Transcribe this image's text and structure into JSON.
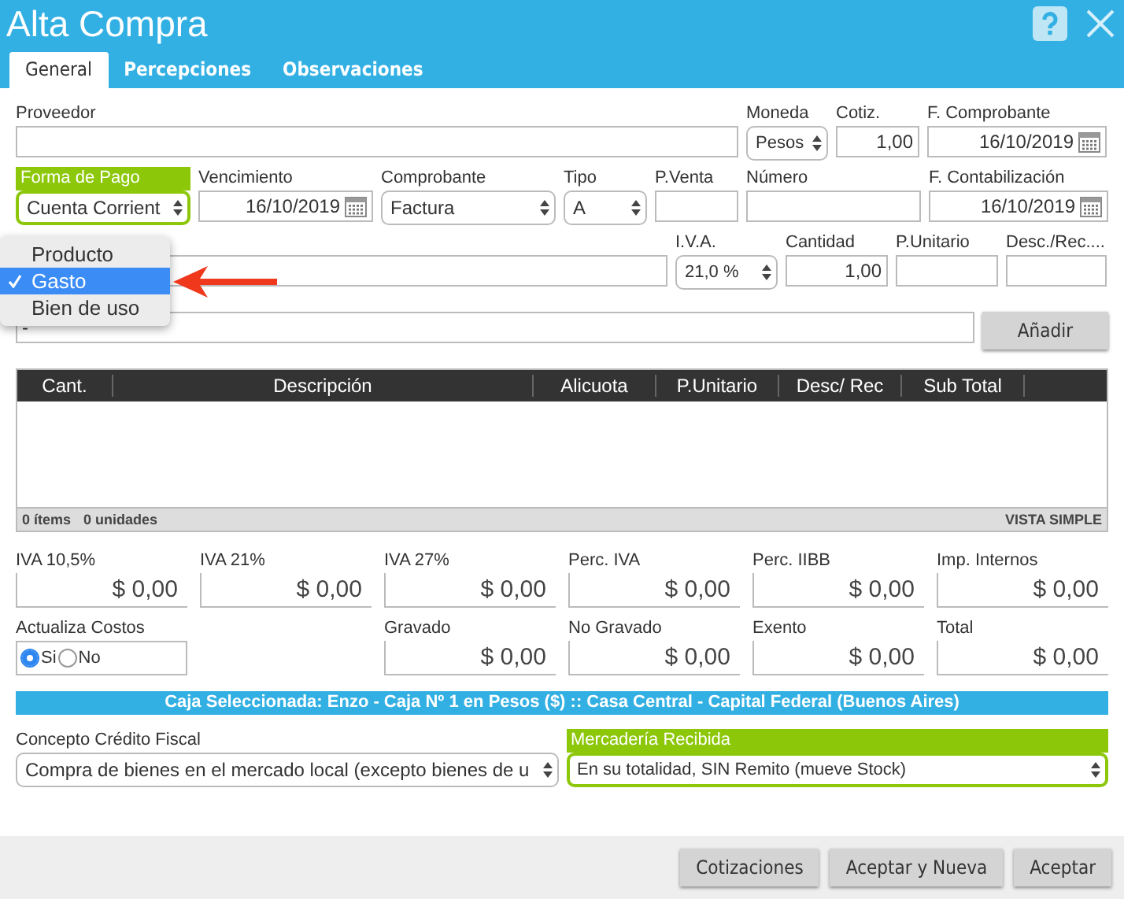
{
  "window": {
    "title": "Alta Compra"
  },
  "tabs": [
    {
      "label": "General",
      "selected": true
    },
    {
      "label": "Percepciones",
      "selected": false
    },
    {
      "label": "Observaciones",
      "selected": false
    }
  ],
  "form_rows": [
    [
      {
        "label": "Proveedor",
        "kind": "text",
        "highlighted": false
      },
      {
        "label": "Moneda",
        "kind": "select",
        "value": "Pesos",
        "highlighted": false
      },
      {
        "label": "Cotiz.",
        "kind": "number",
        "value": "1,00",
        "highlighted": false
      },
      {
        "label": "F. Comprobante",
        "kind": "date",
        "value": "16/10/2019",
        "highlighted": false
      }
    ],
    [
      {
        "label": "Forma de Pago",
        "kind": "select",
        "value": "Cuenta Corrient",
        "highlighted": true
      },
      {
        "label": "Vencimiento",
        "kind": "date",
        "value": "16/10/2019",
        "highlighted": false
      },
      {
        "label": "Comprobante",
        "kind": "select",
        "value": "Factura",
        "highlighted": false
      },
      {
        "label": "Tipo",
        "kind": "select",
        "value": "A",
        "highlighted": false
      },
      {
        "label": "P.Venta",
        "kind": "text",
        "highlighted": false
      },
      {
        "label": "Número",
        "kind": "text",
        "highlighted": false
      },
      {
        "label": "F. Contabilización",
        "kind": "date",
        "value": "16/10/2019",
        "highlighted": false
      }
    ],
    [
      {
        "kind": "text"
      },
      {
        "label": "I.V.A.",
        "kind": "select",
        "value": "21,0 %",
        "highlighted": false
      },
      {
        "label": "Cantidad",
        "kind": "number",
        "value": "1,00",
        "highlighted": false
      },
      {
        "label": "P.Unitario",
        "kind": "number",
        "highlighted": false
      },
      {
        "label": "Desc./Rec....",
        "kind": "number",
        "highlighted": false
      }
    ]
  ],
  "account": {
    "value": "-",
    "button": "Añadir"
  },
  "dropdown": {
    "items": [
      {
        "label": "Producto",
        "selected": false
      },
      {
        "label": "Gasto",
        "selected": true
      },
      {
        "label": "Bien de uso",
        "selected": false
      }
    ]
  },
  "table": {
    "columns": [
      "Cant.",
      "Descripción",
      "Alicuota",
      "P.Unitario",
      "Desc/ Rec",
      "Sub Total"
    ],
    "footer": {
      "items": "0 ítems",
      "units": "0 unidades",
      "view": "VISTA SIMPLE"
    }
  },
  "totals": [
    {
      "label": "IVA 10,5%",
      "value": "$ 0,00"
    },
    {
      "label": "IVA 21%",
      "value": "$ 0,00"
    },
    {
      "label": "IVA 27%",
      "value": "$ 0,00"
    },
    {
      "label": "Perc. IVA",
      "value": "$ 0,00"
    },
    {
      "label": "Perc. IIBB",
      "value": "$ 0,00"
    },
    {
      "label": "Imp. Internos",
      "value": "$ 0,00"
    }
  ],
  "update_costs": {
    "label": "Actualiza Costos",
    "options": [
      {
        "label": "Si",
        "selected": true
      },
      {
        "label": "No",
        "selected": false
      }
    ]
  },
  "subtotals": [
    {
      "label": "Gravado",
      "value": "$ 0,00"
    },
    {
      "label": "No Gravado",
      "value": "$ 0,00"
    },
    {
      "label": "Exento",
      "value": "$ 0,00"
    },
    {
      "label": "Total",
      "value": "$ 0,00"
    }
  ],
  "cash_banner": "Caja Seleccionada: Enzo - Caja Nº 1 en Pesos ($) :: Casa Central - Capital Federal (Buenos Aires)",
  "bottom_fields": [
    {
      "label": "Concepto Crédito Fiscal",
      "value": "Compra de bienes en el mercado local (excepto bienes de u",
      "highlighted": false
    },
    {
      "label": "Mercadería Recibida",
      "value": "En su totalidad, SIN Remito (mueve Stock)",
      "highlighted": true
    }
  ],
  "buttons": [
    "Cotizaciones",
    "Aceptar y Nueva",
    "Aceptar"
  ]
}
